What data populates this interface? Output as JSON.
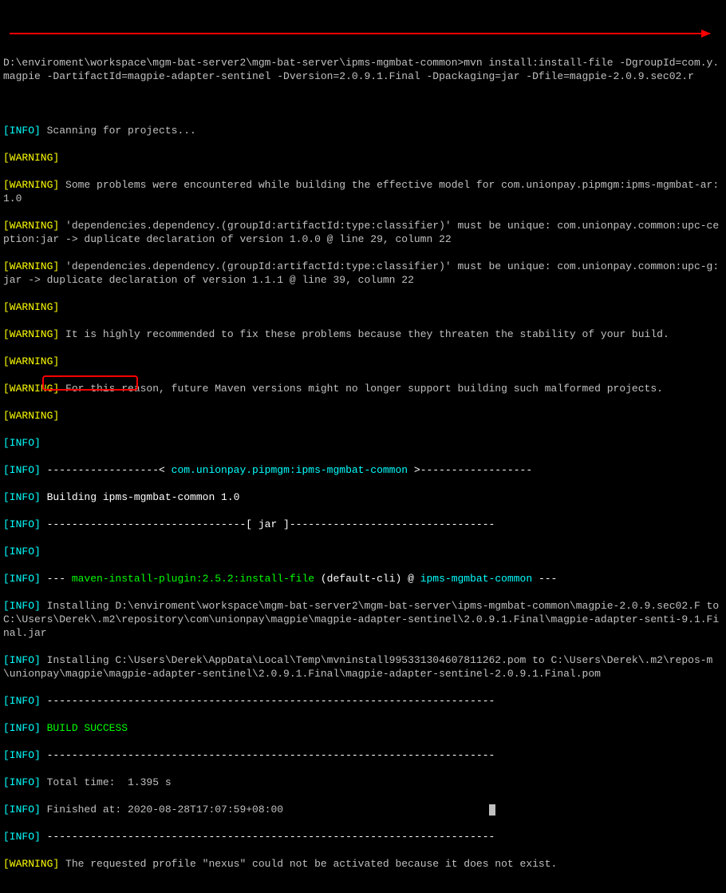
{
  "cmd": {
    "prompt": "D:\\enviroment\\workspace\\mgm-bat-server2\\mgm-bat-server\\ipms-mgmbat-common>",
    "command": "mvn install:install-file -DgroupId=com.y.magpie -DartifactId=magpie-adapter-sentinel -Dversion=2.0.9.1.Final -Dpackaging=jar -Dfile=magpie-2.0.9.sec02.r"
  },
  "tag": {
    "info": "[INFO]",
    "warn": "[WARNING]"
  },
  "l": {
    "scan": " Scanning for projects...",
    "w1": " Some problems were encountered while building the effective model for com.unionpay.pipmgm:ipms-mgmbat-ar:1.0",
    "w2": " 'dependencies.dependency.(groupId:artifactId:type:classifier)' must be unique: com.unionpay.common:upc-ception:jar -> duplicate declaration of version 1.0.0 @ line 29, column 22",
    "w3": " 'dependencies.dependency.(groupId:artifactId:type:classifier)' must be unique: com.unionpay.common:upc-g:jar -> duplicate declaration of version 1.1.1 @ line 39, column 22",
    "w4": " It is highly recommended to fix these problems because they threaten the stability of your build.",
    "w5": " For this reason, future Maven versions might no longer support building such malformed projects.",
    "dash1a": " ------------------< ",
    "proj": "com.unionpay.pipmgm:ipms-mgmbat-common",
    "dash1b": " >------------------",
    "build": " Building ipms-mgmbat-common 1.0",
    "jar": " --------------------------------[ jar ]---------------------------------",
    "pluginA": " --- ",
    "plugin": "maven-install-plugin:2.5.2:install-file",
    "pluginB": " (default-cli) @ ",
    "pluginProj": "ipms-mgmbat-common",
    "pluginC": " ---",
    "inst1": " Installing D:\\enviroment\\workspace\\mgm-bat-server2\\mgm-bat-server\\ipms-mgmbat-common\\magpie-2.0.9.sec02.F to C:\\Users\\Derek\\.m2\\repository\\com\\unionpay\\magpie\\magpie-adapter-sentinel\\2.0.9.1.Final\\magpie-adapter-senti-9.1.Final.jar",
    "inst2": " Installing C:\\Users\\Derek\\AppData\\Local\\Temp\\mvninstall995331304607811262.pom to C:\\Users\\Derek\\.m2\\repos-m\\unionpay\\magpie\\magpie-adapter-sentinel\\2.0.9.1.Final\\magpie-adapter-sentinel-2.0.9.1.Final.pom",
    "sep": " ------------------------------------------------------------------------",
    "success": "BUILD SUCCESS",
    "time": " Total time:  1.395 s",
    "finished": " Finished at: 2020-08-28T17:07:59+08:00",
    "wlast": " The requested profile \"nexus\" could not be activated because it does not exist."
  }
}
